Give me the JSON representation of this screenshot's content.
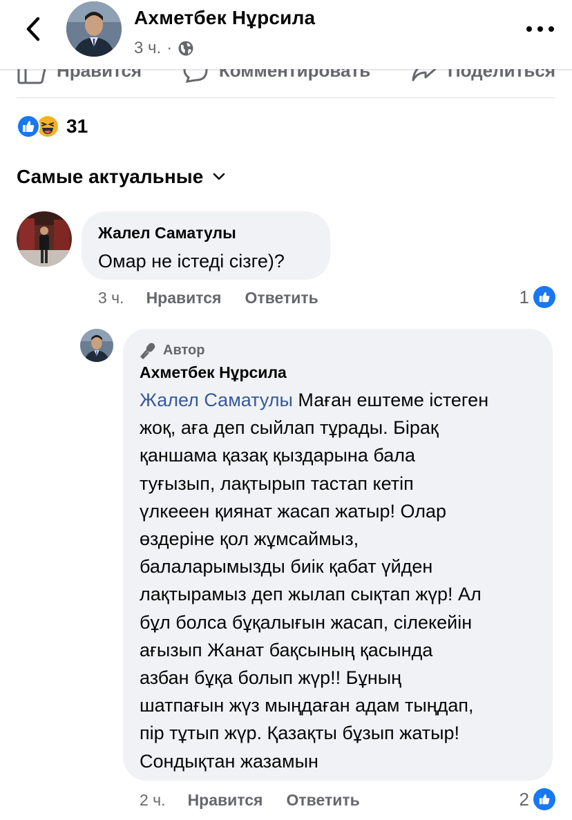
{
  "header": {
    "name": "Ахметбек Нұрсила",
    "time": "3 ч.",
    "separator": "·"
  },
  "actions": {
    "like": "Нравится",
    "comment": "Комментировать",
    "share": "Поделиться"
  },
  "reactions": {
    "count": "31",
    "types": [
      "like",
      "haha"
    ]
  },
  "sort": {
    "label": "Самые актуальные"
  },
  "comments": [
    {
      "author": "Жалел Саматулы",
      "text": "Омар не істеді сізге)?",
      "time": "3 ч.",
      "like_label": "Нравится",
      "reply_label": "Ответить",
      "likes": "1"
    },
    {
      "badge": "Автор",
      "author": "Ахметбек Нұрсила",
      "mention": "Жалел Саматулы",
      "text_lines": [
        " Маған ештеме істеген",
        "жоқ, аға деп сыйлап тұрады. Бірақ",
        "қаншама қазақ қыздарына бала",
        "туғызып, лақтырып тастап кетіп",
        "үлкееен қиянат жасап жатыр! Олар",
        "өздеріне қол жұмсаймыз,",
        "балаларымызды биік қабат үйден",
        "лақтырамыз деп жылап сықтап жүр! Ал",
        "бұл болса бұқалығын жасап, сілекейін",
        "ағызып Жанат бақсының қасында",
        "азбан бұқа болып жүр!! Бұның",
        "шатпағын жүз мыңдаған адам тыңдап,",
        "пір тұтып жүр. Қазақты бұзып жатыр!",
        "Сондықтан жазамын"
      ],
      "time": "2 ч.",
      "like_label": "Нравится",
      "reply_label": "Ответить",
      "likes": "2"
    }
  ],
  "colors": {
    "facebook_blue": "#1877f2",
    "bubble_bg": "#f0f2f5",
    "secondary_text": "#65676b",
    "mention_blue": "#385898"
  }
}
